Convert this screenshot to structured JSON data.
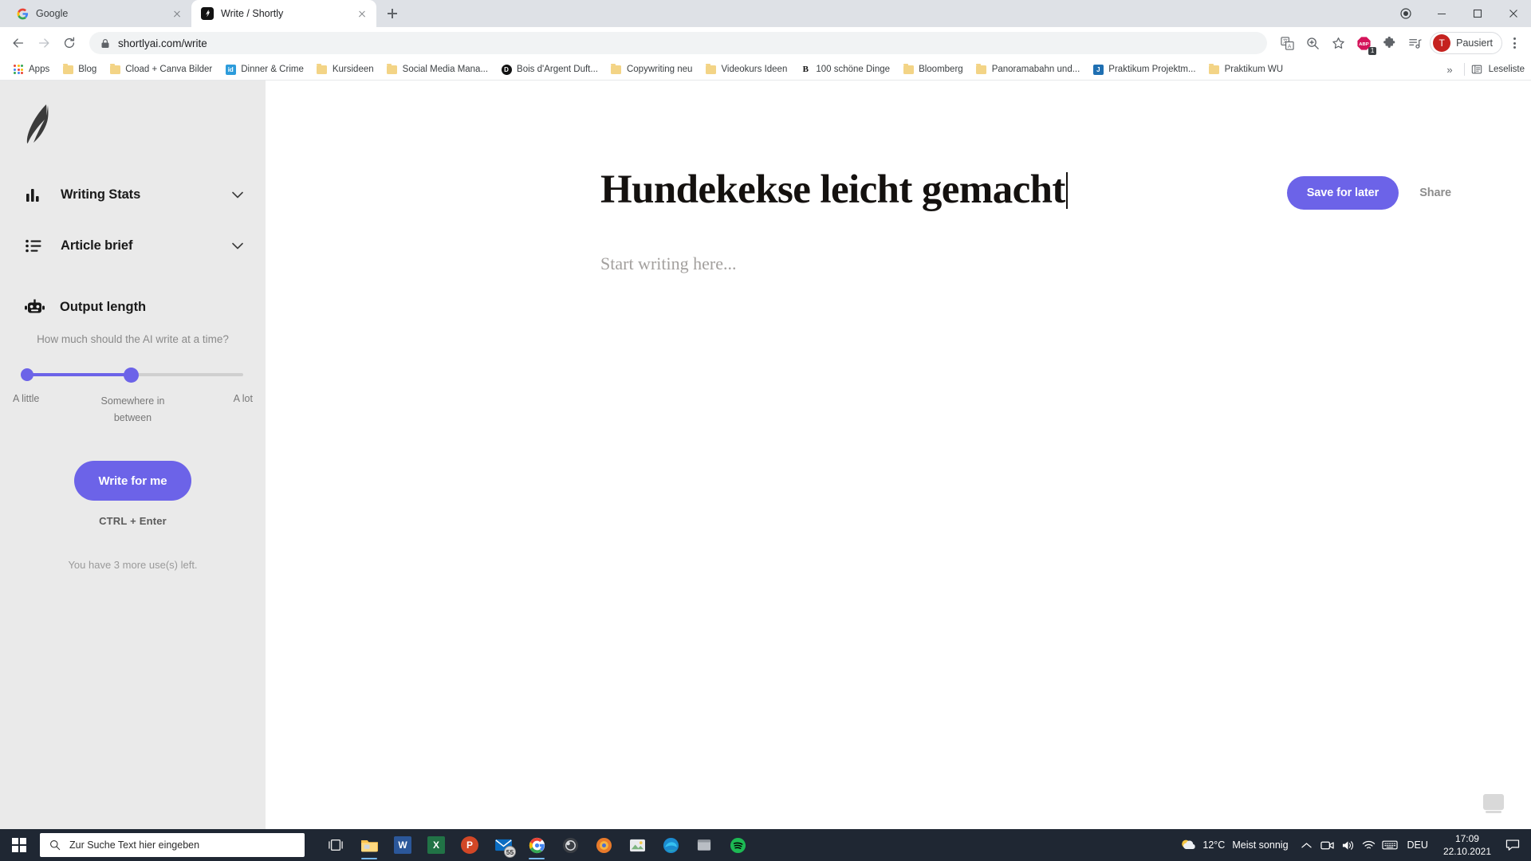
{
  "browser": {
    "tabs": [
      {
        "title": "Google",
        "favicon": "google-icon",
        "active": false
      },
      {
        "title": "Write / Shortly",
        "favicon": "shortlyai-icon",
        "active": true
      }
    ],
    "new_tab_label": "+",
    "window_controls": {
      "minimize": "–",
      "maximize": "❐",
      "close": "✕",
      "record": "●"
    },
    "omnibox": {
      "url": "shortlyai.com/write",
      "lock_icon": "lock-icon"
    },
    "toolbar_icons": [
      "back-icon",
      "forward-icon",
      "reload-icon",
      "translate-icon",
      "zoom-icon",
      "bookmark-star-icon",
      "adblock-icon",
      "extensions-icon",
      "media-icon"
    ],
    "adblock_badge": "1",
    "profile": {
      "initial": "T",
      "label": "Pausiert"
    },
    "bookmarks": [
      {
        "label": "Apps",
        "icon": "apps-grid-icon"
      },
      {
        "label": "Blog",
        "icon": "folder-icon"
      },
      {
        "label": "Cload + Canva Bilder",
        "icon": "folder-icon"
      },
      {
        "label": "Dinner & Crime",
        "icon": "id-icon",
        "icon_text": "id",
        "icon_color": "#2d9cdb"
      },
      {
        "label": "Kursideen",
        "icon": "folder-icon"
      },
      {
        "label": "Social Media Mana...",
        "icon": "folder-icon"
      },
      {
        "label": "Bois d'Argent Duft...",
        "icon": "dior-icon",
        "icon_text": "D",
        "icon_color": "#111111"
      },
      {
        "label": "Copywriting neu",
        "icon": "folder-icon"
      },
      {
        "label": "Videokurs Ideen",
        "icon": "folder-icon"
      },
      {
        "label": "100 schöne Dinge",
        "icon": "b-icon",
        "icon_text": "B",
        "icon_color": "#ffffff"
      },
      {
        "label": "Bloomberg",
        "icon": "folder-icon"
      },
      {
        "label": "Panoramabahn und...",
        "icon": "folder-icon"
      },
      {
        "label": "Praktikum Projektm...",
        "icon": "j-icon",
        "icon_text": "J",
        "icon_color": "#1f6fb2"
      },
      {
        "label": "Praktikum WU",
        "icon": "folder-icon"
      }
    ],
    "bookmarks_overflow": "»",
    "reading_list": {
      "label": "Leseliste",
      "icon": "reading-list-icon"
    }
  },
  "sidebar": {
    "logo": "feather-quill-logo",
    "items": [
      {
        "label": "Writing Stats",
        "icon": "bar-chart-icon",
        "chevron": "⌄"
      },
      {
        "label": "Article brief",
        "icon": "list-icon",
        "chevron": "⌄"
      }
    ],
    "output_length": {
      "title": "Output length",
      "icon": "robot-icon",
      "description": "How much should the AI write at a time?",
      "slider": {
        "value_percent": 48,
        "min_label": "A little",
        "mid_label": "Somewhere in between",
        "max_label": "A lot"
      }
    },
    "write_button": "Write for me",
    "shortcut_hint": "CTRL + Enter",
    "uses_left": "You have 3 more use(s) left.",
    "accent_color": "#6c63e8"
  },
  "editor": {
    "save_button": "Save for later",
    "share_link": "Share",
    "title": "Hundekekse leicht gemacht",
    "body_placeholder": "Start writing here..."
  },
  "taskbar": {
    "start": "windows-logo",
    "search_placeholder": "Zur Suche Text hier eingeben",
    "apps": [
      {
        "name": "task-view",
        "label": ""
      },
      {
        "name": "file-explorer",
        "label": ""
      },
      {
        "name": "word",
        "label": "W",
        "color": "#2b579a"
      },
      {
        "name": "excel",
        "label": "X",
        "color": "#217346"
      },
      {
        "name": "powerpoint",
        "label": "P",
        "color": "#d24726"
      },
      {
        "name": "mail",
        "label": "",
        "color": "#0a6cc1",
        "badge": "55"
      },
      {
        "name": "chrome",
        "label": ""
      },
      {
        "name": "obs",
        "label": ""
      },
      {
        "name": "firefox",
        "label": ""
      },
      {
        "name": "photos",
        "label": ""
      },
      {
        "name": "edge",
        "label": ""
      },
      {
        "name": "app-window",
        "label": ""
      },
      {
        "name": "spotify",
        "label": ""
      }
    ],
    "tray": {
      "weather_temp": "12°C",
      "weather_desc": "Meist sonnig",
      "weather_icon": "sun-cloud-icon",
      "chevron": "∧",
      "icons": [
        "meet-icon",
        "volume-icon",
        "wifi-icon",
        "keyboard-icon"
      ],
      "language": "DEU",
      "time": "17:09",
      "date": "22.10.2021",
      "notification_icon": "notification-icon"
    }
  }
}
